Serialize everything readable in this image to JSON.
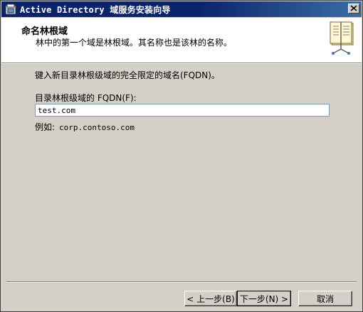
{
  "window": {
    "title": "Active Directory 域服务安装向导",
    "close_glyph": "✕"
  },
  "header": {
    "title": "命名林根域",
    "subtitle": "林中的第一个域是林根域。其名称也是该林的名称。",
    "icon": "book-icon"
  },
  "content": {
    "instruction": "键入新目录林根级域的完全限定的域名(FQDN)。",
    "fqdn_label": "目录林根级域的 FQDN(F):",
    "fqdn_value": "test.com",
    "example_label": "例如:",
    "example_value": "corp.contoso.com"
  },
  "buttons": {
    "back": "< 上一步(B)",
    "next": "下一步(N) >",
    "cancel": "取消"
  },
  "colors": {
    "titlebar_start": "#0a246a",
    "titlebar_end": "#3a6ea5",
    "dialog_bg": "#d4d0c8",
    "header_bg": "#ffffff"
  }
}
